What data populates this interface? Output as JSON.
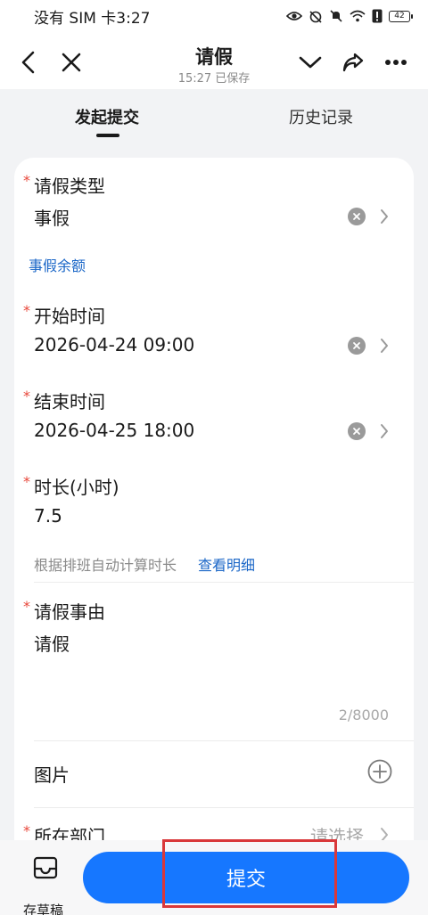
{
  "status_bar": {
    "left_text": "没有 SIM 卡3:27",
    "battery": "42"
  },
  "nav": {
    "title": "请假",
    "subtitle": "15:27 已保存",
    "icons": [
      "back-icon",
      "close-icon",
      "chevron-down-icon",
      "share-icon",
      "more-icon"
    ]
  },
  "tabs": [
    {
      "label": "发起提交",
      "active": true
    },
    {
      "label": "历史记录",
      "active": false
    }
  ],
  "form": {
    "leave_type": {
      "label": "请假类型",
      "value": "事假",
      "required": true
    },
    "balance_link": "事假余额",
    "start_time": {
      "label": "开始时间",
      "value": "2026-04-24 09:00",
      "required": true
    },
    "end_time": {
      "label": "结束时间",
      "value": "2026-04-25 18:00",
      "required": true
    },
    "duration": {
      "label": "时长(小时)",
      "value": "7.5",
      "required": true
    },
    "duration_hint": "根据排班自动计算时长",
    "duration_link": "查看明细",
    "reason": {
      "label": "请假事由",
      "value": "请假",
      "required": true,
      "counter": "2/8000"
    },
    "images": {
      "label": "图片"
    },
    "department": {
      "label": "所在部门",
      "placeholder": "请选择",
      "required": true
    }
  },
  "bottom": {
    "draft_label": "存草稿",
    "submit_label": "提交"
  },
  "colors": {
    "accent": "#1677ff",
    "link": "#1a66c7",
    "required": "#e8473a",
    "highlight": "#d9383a"
  }
}
